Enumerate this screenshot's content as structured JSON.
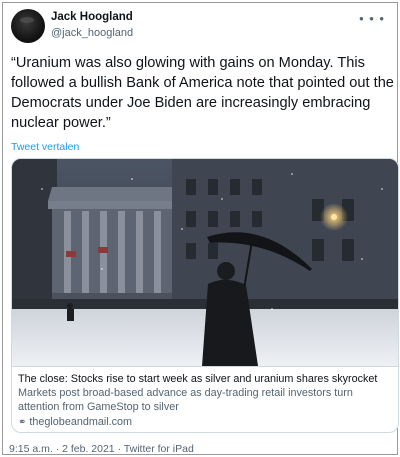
{
  "tweet": {
    "author_name": "Jack Hoogland",
    "author_handle": "@jack_hoogland",
    "text": "“Uranium was also glowing with gains on Monday. This followed a bullish Bank of America note that pointed out the Democrats under Joe Biden are increasingly embracing nuclear power.”",
    "translate_label": "Tweet vertalen",
    "timestamp": "9:15 a.m. · 2 feb. 2021 · Twitter for iPad",
    "more_icon": "more-dots-icon"
  },
  "card": {
    "title": "The close: Stocks rise to start week as silver and uranium shares skyrocket",
    "description": "Markets post broad-based advance as day-trading retail investors turn attention from GameStop to silver",
    "domain": "theglobeandmail.com",
    "link_icon": "link-icon"
  }
}
